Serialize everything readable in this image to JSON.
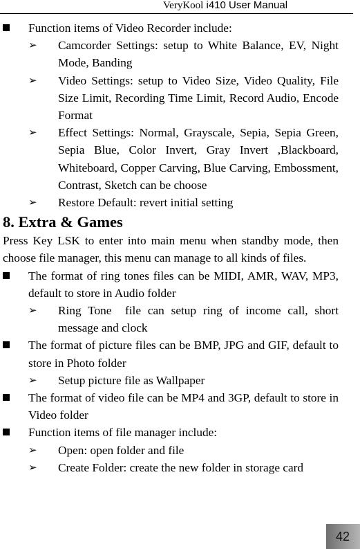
{
  "header": {
    "brand": "VeryKool",
    "model": " i410 User Manual"
  },
  "content": {
    "video_recorder": {
      "title": "Function items of Video Recorder include:",
      "items": [
        "Camcorder Settings: setup to White Balance, EV, Night Mode, Banding",
        "Video Settings: setup to Video Size, Video Quality, File Size Limit, Recording Time Limit, Record Audio, Encode Format",
        "Effect Settings: Normal, Grayscale, Sepia, Sepia Green, Sepia Blue, Color Invert, Gray Invert ,Blackboard, Whiteboard, Copper Carving, Blue Carving, Embossment, Contrast, Sketch can be choose",
        "Restore Default: revert initial setting"
      ]
    },
    "section_heading": "8. Extra & Games",
    "intro": "Press Key LSK to enter into main menu when standby mode, then choose file manager, this menu can manage to all kinds of files.",
    "ring_tones": {
      "title": "The format of ring tones files can be MIDI, AMR, WAV, MP3, default to store in Audio folder",
      "items": [
        "Ring Tone  file can setup ring of income call, short message and clock"
      ]
    },
    "pictures": {
      "title": "The format of picture files can be BMP, JPG and GIF, default to store in Photo folder",
      "items": [
        "Setup picture file as Wallpaper"
      ]
    },
    "video": {
      "title": "The format of video file can be MP4 and 3GP, default to store in Video folder"
    },
    "file_manager": {
      "title": "Function items of file manager include:",
      "items": [
        "Open: open folder and file",
        "Create Folder: create the new folder in storage card"
      ]
    }
  },
  "footer": {
    "page_number": "42"
  },
  "icons": {
    "square_bullet": "■",
    "arrow_bullet": "➢"
  }
}
